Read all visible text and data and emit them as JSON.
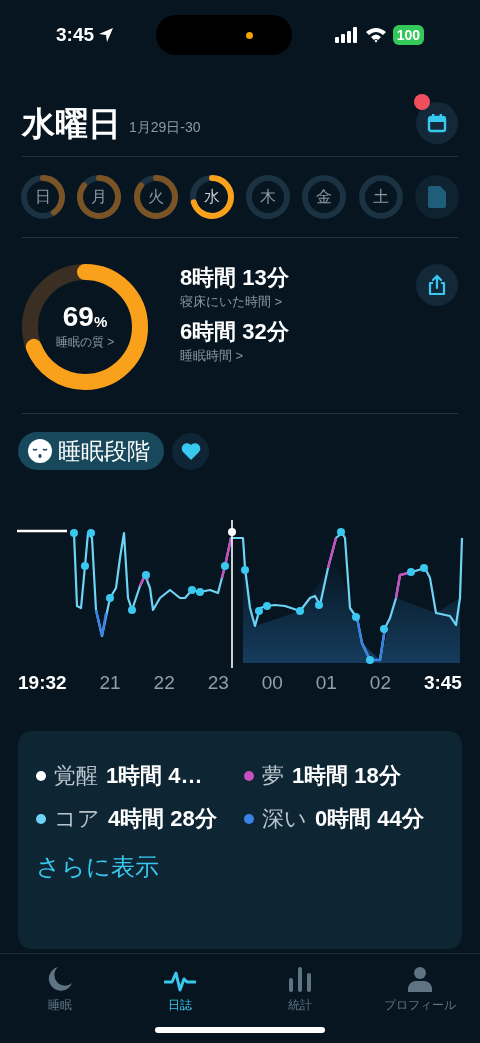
{
  "status_bar": {
    "time": "3:45",
    "battery": "100"
  },
  "header": {
    "title": "水曜日",
    "date_range": "1月29日-30",
    "calendar_badge": true
  },
  "days": [
    {
      "label": "日",
      "selected": false
    },
    {
      "label": "月",
      "selected": false
    },
    {
      "label": "火",
      "selected": false
    },
    {
      "label": "水",
      "selected": true
    },
    {
      "label": "木",
      "selected": false
    },
    {
      "label": "金",
      "selected": false
    },
    {
      "label": "土",
      "selected": false
    }
  ],
  "summary": {
    "quality": "69",
    "quality_unit": "%",
    "quality_label": "睡眠の質 >",
    "stats": [
      {
        "value": "8時間 13分",
        "label": "寝床にいた時間 >"
      },
      {
        "value": "6時間 32分",
        "label": "睡眠時間 >"
      }
    ]
  },
  "stages_chip": {
    "label": "睡眠段階"
  },
  "chart_axis": [
    {
      "label": "19:32",
      "kind": "edge"
    },
    {
      "label": "21",
      "kind": "hour"
    },
    {
      "label": "22",
      "kind": "hour"
    },
    {
      "label": "23",
      "kind": "hour"
    },
    {
      "label": "00",
      "kind": "hour"
    },
    {
      "label": "01",
      "kind": "hour"
    },
    {
      "label": "02",
      "kind": "hour"
    },
    {
      "label": "3:45",
      "kind": "edge"
    }
  ],
  "legend": [
    {
      "label": "覚醒",
      "value": "1時間 4…",
      "color": "#ffffff"
    },
    {
      "label": "夢",
      "value": "1時間 18分",
      "color": "#c84fc0"
    },
    {
      "label": "コア",
      "value": "4時間 28分",
      "color": "#6fd3f5"
    },
    {
      "label": "深い",
      "value": "0時間 44分",
      "color": "#3b82e6"
    }
  ],
  "more_link": "さらに表示",
  "tab_bar": [
    {
      "label": "睡眠",
      "kind": "moon",
      "selected": false
    },
    {
      "label": "日誌",
      "kind": "wave",
      "selected": true
    },
    {
      "label": "統計",
      "kind": "bars",
      "selected": false
    },
    {
      "label": "プロフィール",
      "kind": "person",
      "selected": false
    }
  ]
}
